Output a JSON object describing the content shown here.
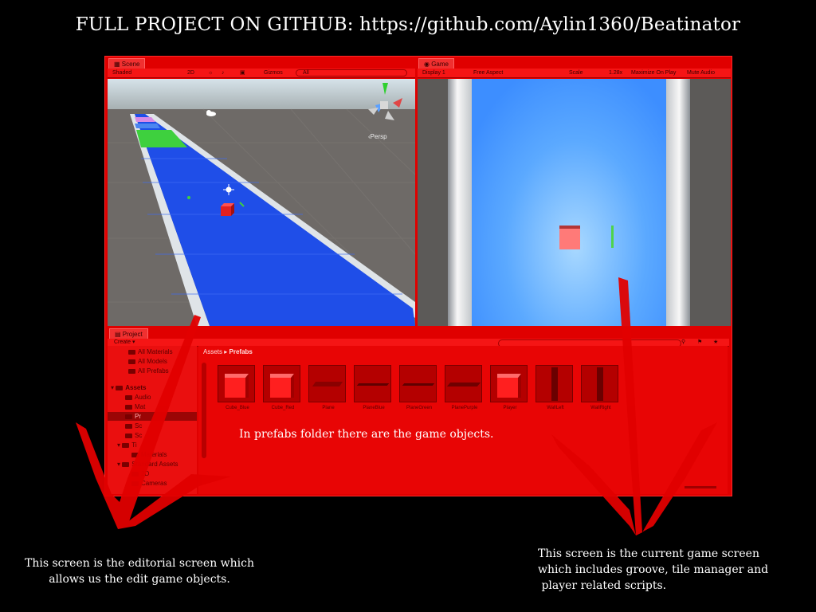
{
  "headline": "FULL PROJECT ON GITHUB: https://github.com/Aylin1360/Beatinator",
  "scene": {
    "tab": "Scene",
    "shading": "Shaded",
    "mode_2d": "2D",
    "gizmos": "Gizmos",
    "search_placeholder": "All",
    "persp": "‹Persp"
  },
  "game": {
    "tab": "Game",
    "display": "Display 1",
    "aspect": "Free Aspect",
    "scale_label": "Scale",
    "scale_value": "1.28x",
    "maximize": "Maximize On Play",
    "mute": "Mute Audio"
  },
  "project": {
    "tab": "Project",
    "create": "Create ▾",
    "breadcrumb_root": "Assets",
    "breadcrumb_sep": "▸",
    "breadcrumb_current": "Prefabs",
    "tree": [
      "All Materials",
      "All Models",
      "All Prefabs",
      "Assets",
      "Audio",
      "Mat",
      "Pr",
      "Sc",
      "Sc",
      "Ti",
      "Materials",
      "Standard Assets",
      "2D",
      "Cameras"
    ],
    "assets": [
      "Cube_Blue",
      "Cube_Red",
      "Plane",
      "PlaneBlue",
      "PlaneGreen",
      "PlanePurple",
      "Player",
      "WallLeft",
      "WallRight"
    ]
  },
  "notes": {
    "prefabs": "In prefabs folder there are the game objects.",
    "editor_line1": "This screen is the editorial screen which",
    "editor_line2": "allows us the edit game objects.",
    "game_line1": "This screen is the current game screen",
    "game_line2": "which includes groove, tile manager and",
    "game_line3": " player related scripts."
  },
  "colors": {
    "overlay_red": "#e00000",
    "track_blue": "#1f4ee8",
    "tile_green": "#3ed03e",
    "tile_pink": "#d78ae6",
    "cube_red": "#e22020"
  },
  "icons": {
    "scene_gizmo": "axis-gizmo-icon",
    "light": "sun-icon",
    "cloud": "cloud-icon",
    "arrows": "red-brush-arrow-icon"
  }
}
